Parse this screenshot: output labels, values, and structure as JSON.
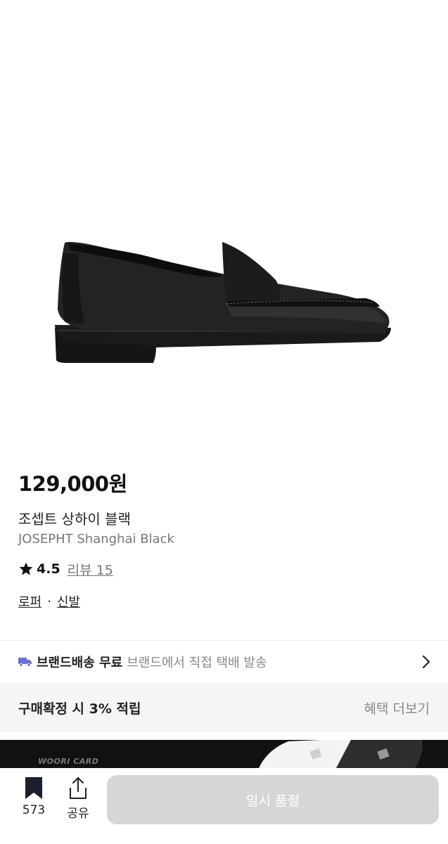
{
  "product": {
    "price": "129,000원",
    "name_ko": "조셉트 상하이 블랙",
    "name_en": "JOSEPHT Shanghai Black",
    "rating": "4.5",
    "review_label": "리뷰 15",
    "category_1": "로퍼",
    "category_separator": "·",
    "category_2": "신발"
  },
  "delivery": {
    "title": "브랜드배송 무료",
    "description": "브랜드에서 직접 택배 발송"
  },
  "benefit": {
    "points_text": "구매확정 시 3% 적립",
    "more_label": "혜택 더보기"
  },
  "banner": {
    "card_label": "WOORI CARD"
  },
  "bottom_bar": {
    "like_count": "573",
    "share_label": "공유",
    "purchase_label": "일시 품절"
  },
  "icons": {
    "rating": "star-icon",
    "delivery": "truck-icon",
    "delivery_more": "chevron-right-icon",
    "like": "bookmark-icon",
    "share": "share-icon"
  },
  "colors": {
    "delivery_icon": "#6b6fd6",
    "soldout_button": "#d6d6d6"
  }
}
